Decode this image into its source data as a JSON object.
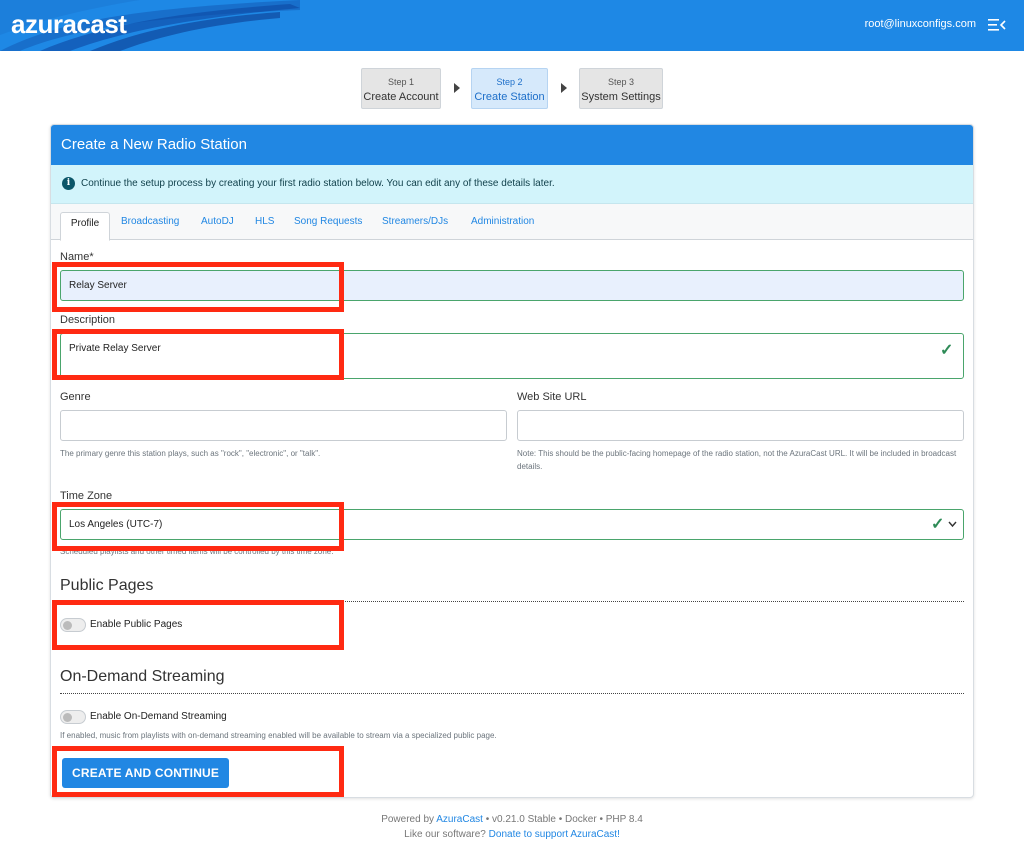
{
  "header": {
    "logo": "azuracast",
    "user_email": "root@linuxconfigs.com",
    "menu_icon": "menu-collapse-icon"
  },
  "steps": [
    {
      "num": "Step 1",
      "name": "Create Account",
      "active": false
    },
    {
      "num": "Step 2",
      "name": "Create Station",
      "active": true
    },
    {
      "num": "Step 3",
      "name": "System Settings",
      "active": false
    }
  ],
  "card": {
    "title": "Create a New Radio Station",
    "info": "Continue the setup process by creating your first radio station below. You can edit any of these details later.",
    "tabs": [
      "Profile",
      "Broadcasting",
      "AutoDJ",
      "HLS",
      "Song Requests",
      "Streamers/DJs",
      "Administration"
    ]
  },
  "form": {
    "name_label": "Name*",
    "name_value": "Relay Server",
    "description_label": "Description",
    "description_value": "Private Relay Server",
    "genre_label": "Genre",
    "genre_value": "",
    "genre_help": "The primary genre this station plays, such as \"rock\", \"electronic\", or \"talk\".",
    "website_label": "Web Site URL",
    "website_value": "",
    "website_help": "Note: This should be the public-facing homepage of the radio station, not the AzuraCast URL. It will be included in broadcast details.",
    "timezone_label": "Time Zone",
    "timezone_value": "Los Angeles (UTC-7)",
    "timezone_help": "Scheduled playlists and other timed items will be controlled by this time zone.",
    "public_pages_heading": "Public Pages",
    "public_pages_toggle": "Enable Public Pages",
    "on_demand_heading": "On-Demand Streaming",
    "on_demand_toggle": "Enable On-Demand Streaming",
    "on_demand_help": "If enabled, music from playlists with on-demand streaming enabled will be available to stream via a specialized public page.",
    "submit_label": "CREATE AND CONTINUE"
  },
  "footer": {
    "powered_by": "Powered by",
    "brand": "AzuraCast",
    "version_info": "• v0.21.0 Stable • Docker • PHP 8.4",
    "like_text": "Like our software?",
    "donate_link": "Donate to support AzuraCast!"
  },
  "colors": {
    "primary": "#2187e3",
    "highlight": "#ff2a12",
    "valid": "#2e8b57",
    "alert_bg": "#d2f4fb"
  }
}
